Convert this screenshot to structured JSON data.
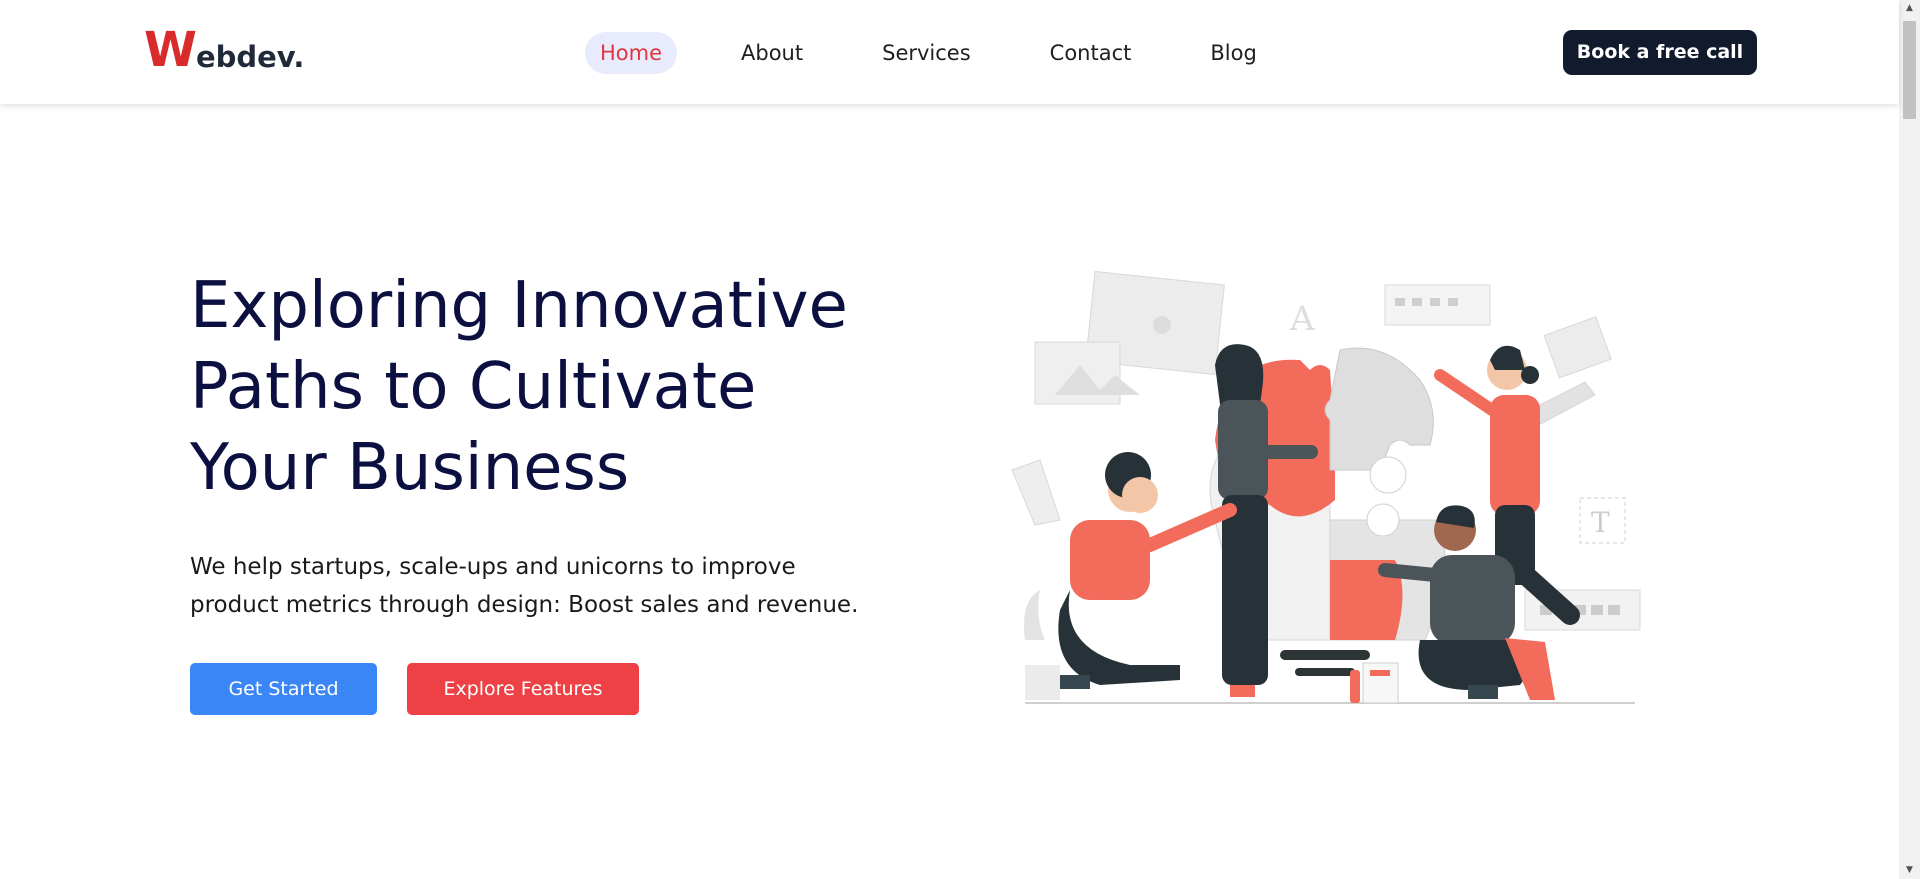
{
  "brand": {
    "logo_initial": "W",
    "logo_rest": "ebdev."
  },
  "nav": {
    "items": [
      {
        "label": "Home",
        "active": true
      },
      {
        "label": "About",
        "active": false
      },
      {
        "label": "Services",
        "active": false
      },
      {
        "label": "Contact",
        "active": false
      },
      {
        "label": "Blog",
        "active": false
      }
    ],
    "cta_label": "Book a free call"
  },
  "hero": {
    "title_lines": [
      "Exploring Innovative",
      "Paths to Cultivate",
      "Your Business"
    ],
    "subtitle_lines": [
      "We help startups, scale-ups and unicorns to improve",
      "product metrics through design: Boost sales and revenue."
    ],
    "primary_button": "Get Started",
    "secondary_button": "Explore Features",
    "illustration": "team-assembling-puzzle-lightbulb-illustration"
  },
  "colors": {
    "brand_red": "#d92b2b",
    "nav_active_bg": "#e7ebfb",
    "nav_active_text": "#e0363f",
    "cta_dark": "#121a2e",
    "title_navy": "#0b1040",
    "primary_blue": "#3b86f6",
    "secondary_red": "#ee4146",
    "illustration_coral": "#f26b5b"
  },
  "icons": {
    "scroll_up": "▲",
    "scroll_down": "▼"
  }
}
